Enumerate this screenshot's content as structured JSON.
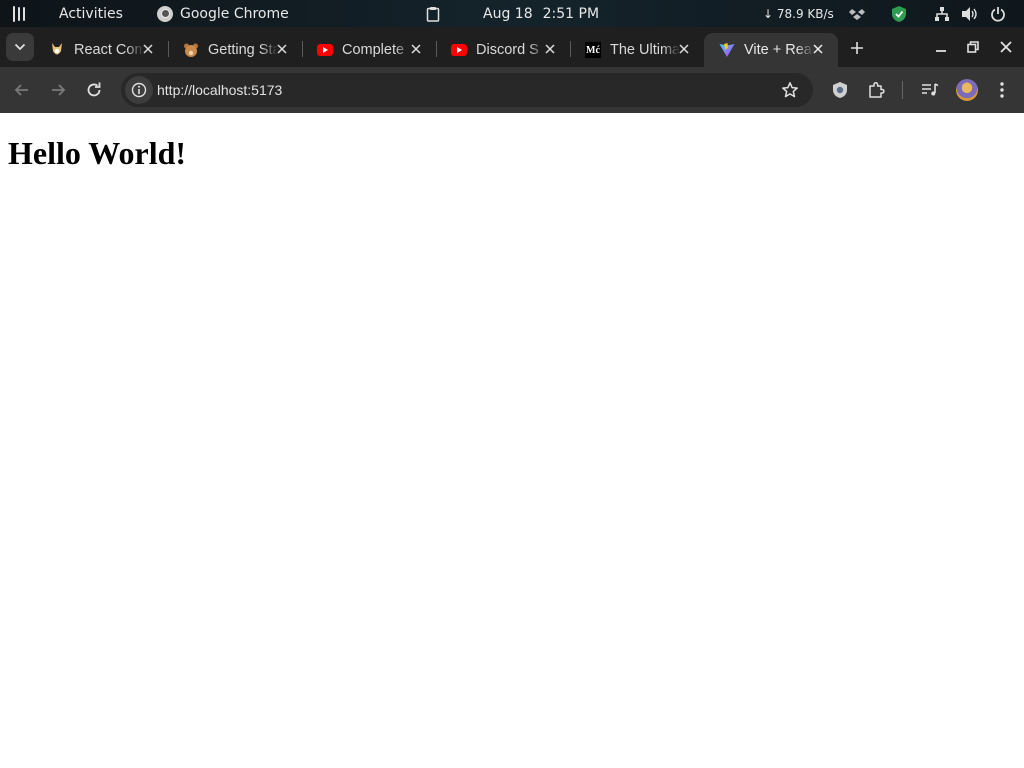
{
  "topbar": {
    "activities": "Activities",
    "app_name": "Google Chrome",
    "date": "Aug 18",
    "time": "2:51 PM",
    "net_speed": "↓ 78.9 KB/s"
  },
  "tabs": [
    {
      "title": "React Compiler",
      "favicon": "react-compiler-favicon",
      "active": false
    },
    {
      "title": "Getting Started",
      "favicon": "bear-favicon",
      "active": false
    },
    {
      "title": "Complete",
      "favicon": "youtube-favicon",
      "active": false
    },
    {
      "title": "Discord S",
      "favicon": "youtube-favicon",
      "active": false
    },
    {
      "title": "The Ultimate",
      "favicon": "medium-favicon",
      "active": false
    },
    {
      "title": "Vite + React",
      "favicon": "vite-favicon",
      "active": true
    }
  ],
  "medium_favicon_text": "Mć",
  "omnibox": {
    "url": "http://localhost:5173"
  },
  "page": {
    "heading": "Hello World!"
  },
  "colors": {
    "tabstrip_bg": "#1f1f1f",
    "toolbar_bg": "#353535",
    "omnibox_bg": "#282828",
    "youtube_red": "#ff0000"
  }
}
